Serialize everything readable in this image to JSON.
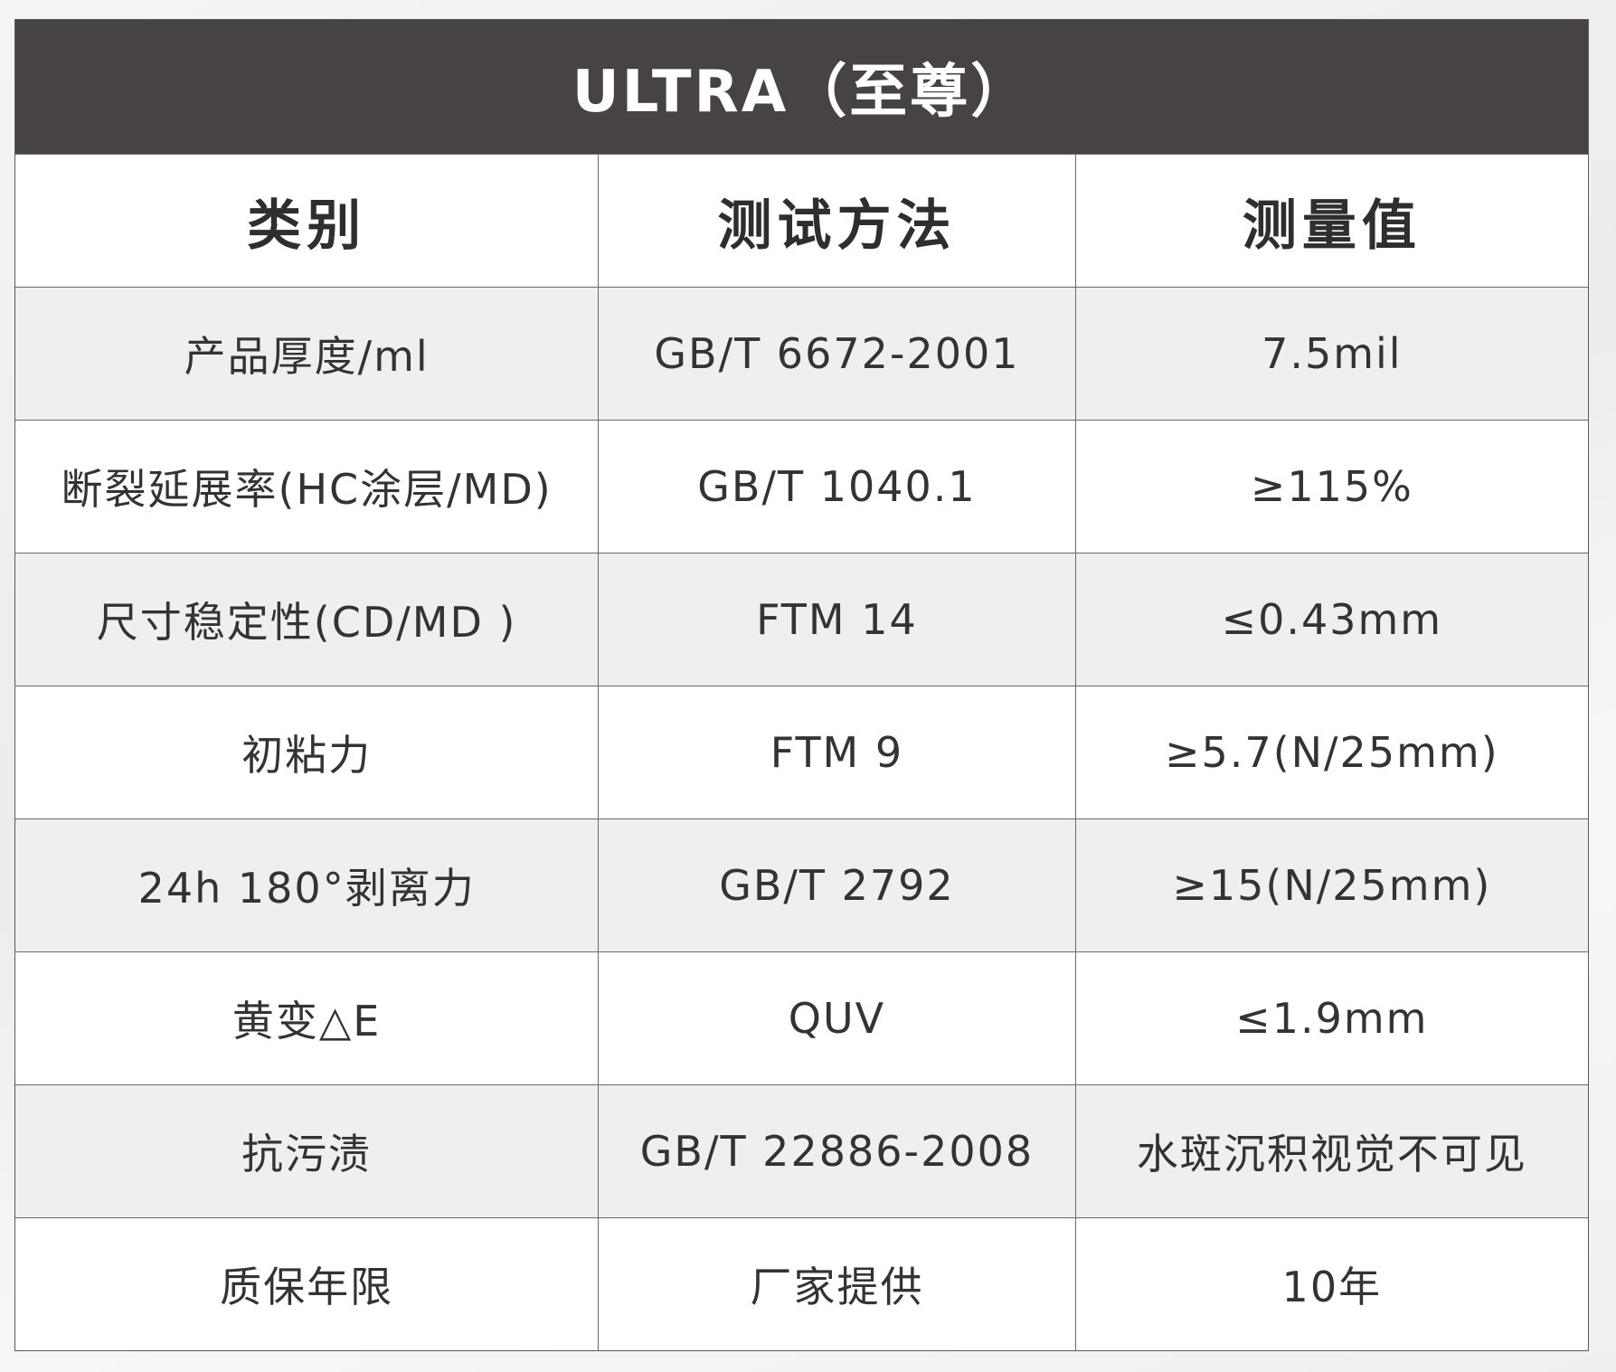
{
  "title": "ULTRA（至尊）",
  "headers": [
    "类别",
    "测试方法",
    "测量值"
  ],
  "rows": [
    {
      "category": "产品厚度/ml",
      "method": "GB/T 6672-2001",
      "value": "7.5mil"
    },
    {
      "category": "断裂延展率(HC涂层/MD)",
      "method": "GB/T 1040.1",
      "value": "≥115%"
    },
    {
      "category": "尺寸稳定性(CD/MD )",
      "method": "FTM 14",
      "value": "≤0.43mm"
    },
    {
      "category": "初粘力",
      "method": "FTM 9",
      "value": "≥5.7(N/25mm)"
    },
    {
      "category": "24h 180°剥离力",
      "method": "GB/T 2792",
      "value": "≥15(N/25mm)"
    },
    {
      "category": "黄变△E",
      "method": "QUV",
      "value": "≤1.9mm"
    },
    {
      "category": "抗污渍",
      "method": "GB/T 22886-2008",
      "value": "水斑沉积视觉不可见"
    },
    {
      "category": "质保年限",
      "method": "厂家提供",
      "value": "10年"
    }
  ],
  "colors": {
    "title_bar": "#464342",
    "title_text": "#ffffff",
    "shaded_row": "#efefef",
    "text": "#333333"
  }
}
